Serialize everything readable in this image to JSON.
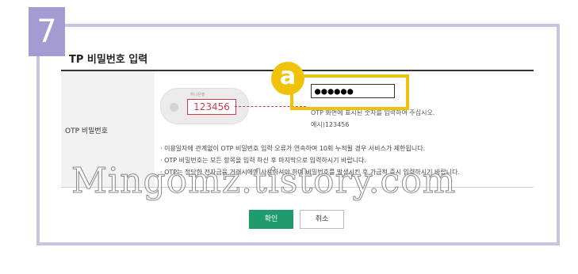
{
  "step": {
    "number": "7"
  },
  "section": {
    "title": "TP 비밀번호 입력"
  },
  "form": {
    "otp_label": "OTP 비밀번호",
    "token_brand": "하나은행",
    "token_code": "123456",
    "password_value": "●●●●●●",
    "marker_letter": "a",
    "hint": "OTP 화면에 표시된 숫자를 입력하여 주십시오.",
    "example": "예시)123456"
  },
  "notes": [
    "이용일자에 관계없이 OTP 비밀번호 입력 오류가 연속하여 10회 누적될 경우 서비스가 제한됩니다.",
    "OTP 비밀번호는 모든 항목을 입력 하신 후 마지막으로 입력하시기 바랍니다.",
    "OTP는 정당한 전자금융 거래시에만 사용하셔야 하며 비밀번호를 발생시킨 후 가급적 즉시 입력하시기 바랍니다."
  ],
  "watermark": "Mingomz.tistory.com",
  "buttons": {
    "confirm": "확인",
    "cancel": "취소"
  },
  "colors": {
    "highlight": "#f0c20a",
    "badge": "#a59bd3",
    "confirm": "#1f9b6e",
    "otp_red": "#d23a4c"
  }
}
